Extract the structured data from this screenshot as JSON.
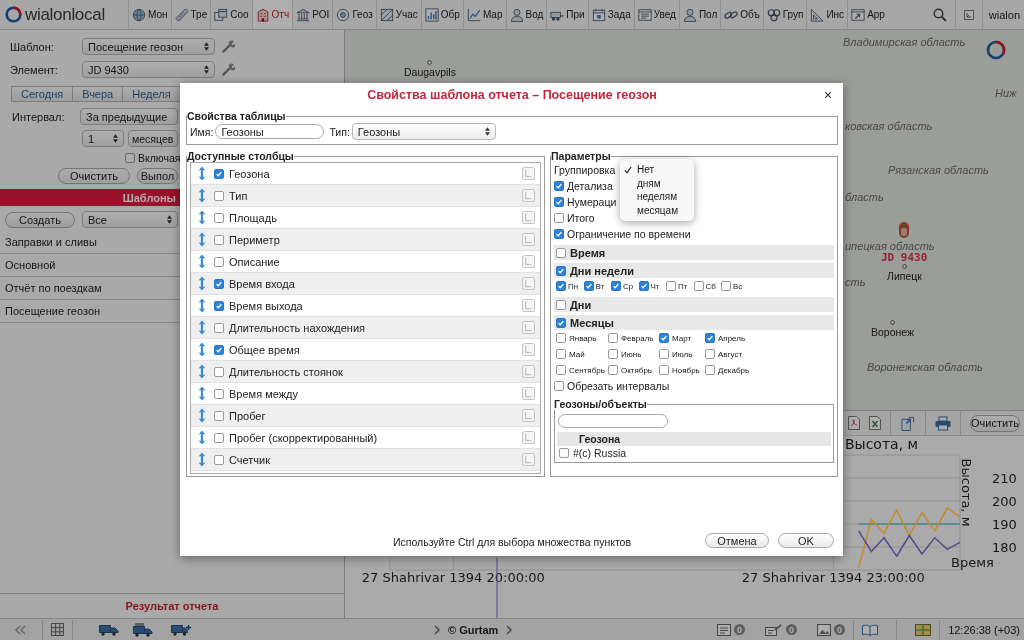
{
  "top_bar": {
    "logo": "wialonlocal",
    "nav": [
      {
        "label": "Мон",
        "selected": false
      },
      {
        "label": "Тре",
        "selected": false
      },
      {
        "label": "Соо",
        "selected": false
      },
      {
        "label": "Отч",
        "selected": true
      },
      {
        "label": "POI",
        "selected": false
      },
      {
        "label": "Геоз",
        "selected": false
      },
      {
        "label": "Учас",
        "selected": false
      },
      {
        "label": "Обр",
        "selected": false
      },
      {
        "label": "Мар",
        "selected": false
      },
      {
        "label": "Вод",
        "selected": false
      },
      {
        "label": "При",
        "selected": false
      },
      {
        "label": "Зада",
        "selected": false
      },
      {
        "label": "Увед",
        "selected": false
      },
      {
        "label": "Пол",
        "selected": false
      },
      {
        "label": "Объ",
        "selected": false
      },
      {
        "label": "Груп",
        "selected": false
      },
      {
        "label": "Инс",
        "selected": false
      },
      {
        "label": "App",
        "selected": false
      }
    ],
    "user": "wialon"
  },
  "left_panel": {
    "fields": [
      {
        "label": "Шаблон:",
        "value": "Посещение геозон"
      },
      {
        "label": "Элемент:",
        "value": "JD 9430"
      }
    ],
    "period_tabs": [
      {
        "label": "Сегодня",
        "selected": false
      },
      {
        "label": "Вчера",
        "selected": false
      },
      {
        "label": "Неделя",
        "selected": false
      }
    ],
    "interval": {
      "label": "Интервал:",
      "mode": "За предыдущие",
      "count": "1",
      "unit": "месяцев"
    },
    "include": {
      "label": "Включая",
      "checked": false
    },
    "buttons": [
      "Очистить",
      "Выпол"
    ],
    "templates_header": "Шаблоны",
    "create_button": "Создать",
    "filter": "Все",
    "templates": [
      {
        "label": "Заправки и сливы",
        "selected": false
      },
      {
        "label": "Основной",
        "selected": false
      },
      {
        "label": "Отчёт по поездкам",
        "selected": false
      },
      {
        "label": "Посещение геозон",
        "selected": false
      }
    ],
    "result_header": "Результат отчета"
  },
  "map": {
    "labels": [
      {
        "text": "Владимирская область",
        "kind": "region"
      },
      {
        "text": "Daugavpils",
        "kind": "city"
      },
      {
        "text": "Ниж",
        "kind": "region"
      },
      {
        "text": "ковская область",
        "kind": "region"
      },
      {
        "text": "Рязанская область",
        "kind": "region"
      },
      {
        "text": "бласть",
        "kind": "region"
      },
      {
        "text": "ипецкая область",
        "kind": "region"
      },
      {
        "text": "JD 9430",
        "kind": "unit"
      },
      {
        "text": "Липецк",
        "kind": "city"
      },
      {
        "text": "сть",
        "kind": "region"
      },
      {
        "text": "Воронеж",
        "kind": "city"
      },
      {
        "text": "Воронежская область",
        "kind": "region"
      }
    ]
  },
  "chart_toolbar": {
    "clear_button": "Очистить"
  },
  "chart": {
    "chart_data": {
      "type": "line",
      "title": "Высота, м",
      "ylabel": "Высота, м",
      "xlabel": "Время",
      "grid": true,
      "categories": [
        null,
        null,
        null,
        null,
        null,
        "27 Shahrivar 1394 20:00:00",
        null,
        null,
        null,
        null,
        null,
        null,
        null,
        null,
        null,
        null,
        null,
        null,
        null,
        null,
        null,
        null,
        null,
        null,
        null,
        null,
        null,
        null,
        null,
        null,
        null,
        null,
        null,
        null,
        null,
        "27 Shahrivar 1394 23:00:00",
        null,
        null,
        null,
        null,
        null,
        null,
        null,
        null,
        null,
        null
      ],
      "ylim": [
        170,
        220
      ],
      "yticks": [
        180,
        190,
        200,
        210
      ],
      "series": [
        {
          "color": "#3f8a8e",
          "values": [
            null,
            null,
            null,
            null,
            null,
            null,
            null,
            null,
            null,
            null,
            null,
            null,
            null,
            null,
            null,
            null,
            null,
            null,
            null,
            null,
            null,
            null,
            null,
            null,
            null,
            null,
            null,
            null,
            null,
            null,
            null,
            null,
            null,
            null,
            null,
            null,
            null,
            190,
            190,
            190,
            190,
            190,
            190,
            190,
            190,
            190
          ]
        },
        {
          "color": "#c58a2e",
          "values": [
            null,
            null,
            null,
            null,
            null,
            null,
            null,
            null,
            null,
            null,
            null,
            null,
            null,
            null,
            null,
            null,
            null,
            null,
            null,
            null,
            null,
            null,
            null,
            null,
            null,
            null,
            null,
            null,
            null,
            null,
            null,
            null,
            null,
            null,
            null,
            null,
            null,
            171,
            192,
            186,
            196,
            185,
            195,
            187,
            197,
            193
          ]
        },
        {
          "color": "#58488c",
          "values": [
            null,
            null,
            null,
            null,
            null,
            null,
            null,
            null,
            null,
            null,
            null,
            null,
            null,
            null,
            null,
            null,
            null,
            null,
            null,
            null,
            null,
            null,
            null,
            null,
            null,
            null,
            null,
            null,
            null,
            null,
            null,
            null,
            null,
            null,
            null,
            null,
            null,
            187,
            178,
            184,
            176,
            185,
            177,
            184,
            179,
            182
          ]
        }
      ]
    }
  },
  "dialog": {
    "title": "Свойства шаблона отчета – Посещение геозон",
    "table_props": {
      "legend": "Свойства таблицы",
      "name_label": "Имя:",
      "name_value": "Геозоны",
      "type_label": "Тип:",
      "type_value": "Геозоны"
    },
    "columns": {
      "legend": "Доступные столбцы",
      "items": [
        {
          "label": "Геозона",
          "checked": true
        },
        {
          "label": "Тип",
          "checked": false
        },
        {
          "label": "Площадь",
          "checked": false
        },
        {
          "label": "Периметр",
          "checked": false
        },
        {
          "label": "Описание",
          "checked": false
        },
        {
          "label": "Время входа",
          "checked": true
        },
        {
          "label": "Время выхода",
          "checked": true
        },
        {
          "label": "Длительность нахождения",
          "checked": false
        },
        {
          "label": "Общее время",
          "checked": true
        },
        {
          "label": "Длительность стоянок",
          "checked": false
        },
        {
          "label": "Время между",
          "checked": false
        },
        {
          "label": "Пробег",
          "checked": false
        },
        {
          "label": "Пробег (скорректированный)",
          "checked": false
        },
        {
          "label": "Счетчик",
          "checked": false
        }
      ]
    },
    "params": {
      "legend": "Параметры",
      "grouping": {
        "label": "Группировка",
        "options": [
          {
            "label": "Нет",
            "selected": true
          },
          {
            "label": "дням",
            "selected": false
          },
          {
            "label": "неделям",
            "selected": false
          },
          {
            "label": "месяцам",
            "selected": false
          }
        ]
      },
      "rows": [
        {
          "kind": "option",
          "label": "Детализа",
          "checked": true
        },
        {
          "kind": "option",
          "label": "Нумераци",
          "checked": true
        },
        {
          "kind": "option",
          "label": "Итого",
          "checked": false
        },
        {
          "kind": "option",
          "label": "Ограничение по времени",
          "checked": true
        },
        {
          "kind": "header",
          "label": "Время",
          "checked": false
        },
        {
          "kind": "header",
          "label": "Дни недели",
          "checked": true
        },
        {
          "kind": "days",
          "items": [
            {
              "label": "Пн",
              "checked": true
            },
            {
              "label": "Вт",
              "checked": true
            },
            {
              "label": "Ср",
              "checked": true
            },
            {
              "label": "Чт",
              "checked": true
            },
            {
              "label": "Пт",
              "checked": false
            },
            {
              "label": "Сб",
              "checked": false
            },
            {
              "label": "Вс",
              "checked": false
            }
          ]
        },
        {
          "kind": "header",
          "label": "Дни",
          "checked": false
        },
        {
          "kind": "header",
          "label": "Месяцы",
          "checked": true
        },
        {
          "kind": "months",
          "items": [
            {
              "label": "Январь",
              "checked": false
            },
            {
              "label": "Февраль",
              "checked": false
            },
            {
              "label": "Март",
              "checked": true
            },
            {
              "label": "Апрель",
              "checked": true
            },
            {
              "label": "Май",
              "checked": false
            },
            {
              "label": "Июнь",
              "checked": false
            },
            {
              "label": "Июль",
              "checked": false
            },
            {
              "label": "Август",
              "checked": false
            },
            {
              "label": "Сентябрь",
              "checked": false
            },
            {
              "label": "Октябрь",
              "checked": false
            },
            {
              "label": "Ноябрь",
              "checked": false
            },
            {
              "label": "Декабрь",
              "checked": false
            }
          ]
        },
        {
          "kind": "option",
          "label": "Обрезать интервалы",
          "checked": false
        }
      ],
      "objects": {
        "legend": "Геозоны/объекты",
        "column": "Геозона",
        "rows": [
          {
            "label": "#(c) Russia",
            "checked": false
          }
        ]
      }
    },
    "hint": "Используйте Ctrl для выбора множества пунктов",
    "buttons": [
      "Отмена",
      "OK"
    ]
  },
  "status_bar": {
    "copyright": "© Gurtam",
    "counters": [
      "0",
      "0",
      "0"
    ],
    "time": "12:26:38 (+03)"
  }
}
